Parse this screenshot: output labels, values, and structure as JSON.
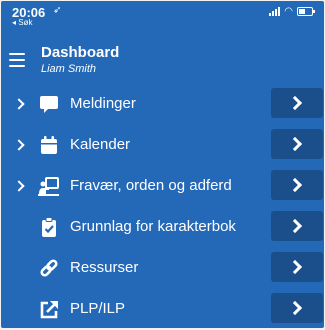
{
  "status_bar": {
    "time": "20:06",
    "location_arrow": "➶",
    "back_link": "◂ Søk"
  },
  "header": {
    "title": "Dashboard",
    "subtitle": "Liam Smith"
  },
  "menu_items": [
    {
      "label": "Meldinger",
      "icon": "chat-bubble-icon",
      "expandable": true
    },
    {
      "label": "Kalender",
      "icon": "calendar-icon",
      "expandable": true
    },
    {
      "label": "Fravær, orden og adferd",
      "icon": "presentation-board-icon",
      "expandable": true
    },
    {
      "label": "Grunnlag for karakterbok",
      "icon": "clipboard-check-icon",
      "expandable": false
    },
    {
      "label": "Ressurser",
      "icon": "link-icon",
      "expandable": false
    },
    {
      "label": "PLP/ILP",
      "icon": "external-link-icon",
      "expandable": false
    }
  ],
  "colors": {
    "background": "#2468b8",
    "action_button": "#1b4f8c",
    "text": "#ffffff"
  }
}
